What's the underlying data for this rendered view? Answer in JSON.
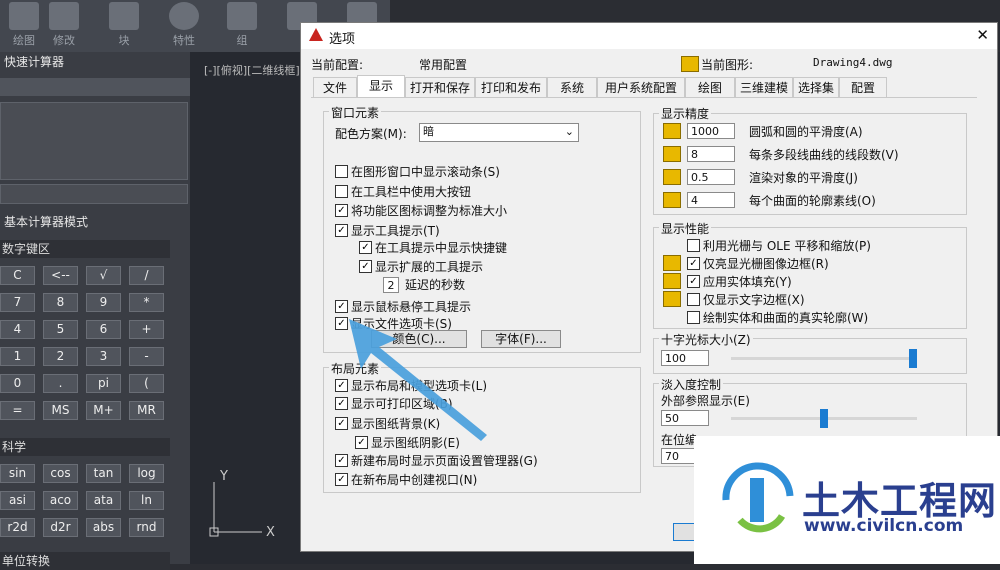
{
  "ribbon": {
    "buttons": [
      "绘图",
      "修改",
      "块",
      "特性",
      "组",
      "",
      ""
    ]
  },
  "left_panel": {
    "title": "快速计算器",
    "mode_label": "基本计算器模式",
    "numpad_title": "数字键区",
    "numpad_keys": [
      [
        "C",
        "<--",
        "√",
        "/"
      ],
      [
        "7",
        "8",
        "9",
        "*"
      ],
      [
        "4",
        "5",
        "6",
        "+"
      ],
      [
        "1",
        "2",
        "3",
        "-"
      ],
      [
        "0",
        ".",
        "pi",
        "("
      ],
      [
        "=",
        "MS",
        "M+",
        "MR"
      ]
    ],
    "science_title": "科学",
    "science_keys": [
      [
        "sin",
        "cos",
        "tan",
        "log"
      ],
      [
        "asi",
        "aco",
        "ata",
        "ln"
      ],
      [
        "r2d",
        "d2r",
        "abs",
        "rnd"
      ]
    ],
    "unit_title": "单位转换"
  },
  "viewport_label": "[-][俯视][二维线框]",
  "dialog": {
    "title": "选项",
    "close_label": "✕",
    "current_profile_label": "当前配置:",
    "current_profile_value": "常用配置",
    "current_drawing_label": "当前图形:",
    "current_drawing_value": "Drawing4.dwg",
    "tabs": [
      "文件",
      "显示",
      "打开和保存",
      "打印和发布",
      "系统",
      "用户系统配置",
      "绘图",
      "三维建模",
      "选择集",
      "配置"
    ],
    "window_elements": {
      "title": "窗口元素",
      "color_scheme_label": "配色方案(M):",
      "color_scheme_value": "暗",
      "options": [
        {
          "label": "在图形窗口中显示滚动条(S)",
          "checked": false
        },
        {
          "label": "在工具栏中使用大按钮",
          "checked": false
        },
        {
          "label": "将功能区图标调整为标准大小",
          "checked": true
        },
        {
          "label": "显示工具提示(T)",
          "checked": true
        },
        {
          "label": "在工具提示中显示快捷键",
          "checked": true
        },
        {
          "label": "显示扩展的工具提示",
          "checked": true
        },
        {
          "label": "显示鼠标悬停工具提示",
          "checked": true
        },
        {
          "label": "显示文件选项卡(S)",
          "checked": true
        }
      ],
      "delay_value": "2",
      "delay_label": "延迟的秒数",
      "colors_button": "颜色(C)...",
      "fonts_button": "字体(F)..."
    },
    "layout_elements": {
      "title": "布局元素",
      "options": [
        {
          "label": "显示布局和模型选项卡(L)",
          "checked": true
        },
        {
          "label": "显示可打印区域(B)",
          "checked": true
        },
        {
          "label": "显示图纸背景(K)",
          "checked": true
        },
        {
          "label": "显示图纸阴影(E)",
          "checked": true
        },
        {
          "label": "新建布局时显示页面设置管理器(G)",
          "checked": true
        },
        {
          "label": "在新布局中创建视口(N)",
          "checked": true
        }
      ]
    },
    "display_resolution": {
      "title": "显示精度",
      "rows": [
        {
          "value": "1000",
          "label": "圆弧和圆的平滑度(A)"
        },
        {
          "value": "8",
          "label": "每条多段线曲线的线段数(V)"
        },
        {
          "value": "0.5",
          "label": "渲染对象的平滑度(J)"
        },
        {
          "value": "4",
          "label": "每个曲面的轮廓素线(O)"
        }
      ]
    },
    "display_performance": {
      "title": "显示性能",
      "options": [
        {
          "label": "利用光栅与 OLE 平移和缩放(P)",
          "checked": false
        },
        {
          "label": "仅亮显光栅图像边框(R)",
          "checked": true
        },
        {
          "label": "应用实体填充(Y)",
          "checked": true
        },
        {
          "label": "仅显示文字边框(X)",
          "checked": false
        },
        {
          "label": "绘制实体和曲面的真实轮廓(W)",
          "checked": false
        }
      ]
    },
    "crosshair": {
      "title": "十字光标大小(Z)",
      "value": "100",
      "level": 1.0
    },
    "fade": {
      "title": "淡入度控制",
      "xref_label": "外部参照显示(E)",
      "xref_value": "50",
      "xref_level": 0.5,
      "inplace_label": "在位编",
      "inplace_value": "70"
    }
  },
  "watermark": {
    "title": "土木工程网",
    "url": "www.civilcn.com"
  },
  "colors": {
    "accent": "#1a7bd1",
    "dialog_bg": "#f0f0f0",
    "bg": "#2b2d33"
  }
}
